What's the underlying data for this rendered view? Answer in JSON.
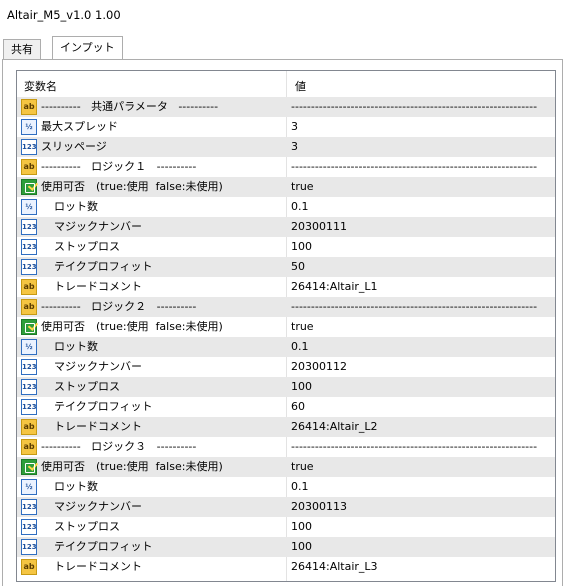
{
  "window": {
    "title": "Altair_M5_v1.0 1.00"
  },
  "tabs": [
    {
      "label": "共有"
    },
    {
      "label": "インプット"
    }
  ],
  "grid": {
    "col_name": "変数名",
    "col_value": "値",
    "rows": [
      {
        "icon": "ab",
        "indent": false,
        "name": "----------   共通パラメータ   ----------",
        "value": "--------------------------------------------------------------"
      },
      {
        "icon": "half",
        "indent": false,
        "name": "最大スプレッド",
        "value": "3"
      },
      {
        "icon": "123",
        "indent": false,
        "name": "スリッページ",
        "value": "3"
      },
      {
        "icon": "ab",
        "indent": false,
        "name": "----------   ロジック１   ----------",
        "value": "--------------------------------------------------------------"
      },
      {
        "icon": "bool",
        "indent": false,
        "name": "使用可否　(true:使用  false:未使用)",
        "value": "true"
      },
      {
        "icon": "half",
        "indent": true,
        "name": "ロット数",
        "value": "0.1"
      },
      {
        "icon": "123",
        "indent": true,
        "name": "マジックナンバー",
        "value": "20300111"
      },
      {
        "icon": "123",
        "indent": true,
        "name": "ストップロス",
        "value": "100"
      },
      {
        "icon": "123",
        "indent": true,
        "name": "テイクプロフィット",
        "value": "50"
      },
      {
        "icon": "ab",
        "indent": true,
        "name": "トレードコメント",
        "value": "26414:Altair_L1"
      },
      {
        "icon": "ab",
        "indent": false,
        "name": "----------   ロジック２   ----------",
        "value": "--------------------------------------------------------------"
      },
      {
        "icon": "bool",
        "indent": false,
        "name": "使用可否　(true:使用  false:未使用)",
        "value": "true"
      },
      {
        "icon": "half",
        "indent": true,
        "name": "ロット数",
        "value": "0.1"
      },
      {
        "icon": "123",
        "indent": true,
        "name": "マジックナンバー",
        "value": "20300112"
      },
      {
        "icon": "123",
        "indent": true,
        "name": "ストップロス",
        "value": "100"
      },
      {
        "icon": "123",
        "indent": true,
        "name": "テイクプロフィット",
        "value": "60"
      },
      {
        "icon": "ab",
        "indent": true,
        "name": "トレードコメント",
        "value": "26414:Altair_L2"
      },
      {
        "icon": "ab",
        "indent": false,
        "name": "----------   ロジック３   ----------",
        "value": "--------------------------------------------------------------"
      },
      {
        "icon": "bool",
        "indent": false,
        "name": "使用可否　(true:使用  false:未使用)",
        "value": "true"
      },
      {
        "icon": "half",
        "indent": true,
        "name": "ロット数",
        "value": "0.1"
      },
      {
        "icon": "123",
        "indent": true,
        "name": "マジックナンバー",
        "value": "20300113"
      },
      {
        "icon": "123",
        "indent": true,
        "name": "ストップロス",
        "value": "100"
      },
      {
        "icon": "123",
        "indent": true,
        "name": "テイクプロフィット",
        "value": "100"
      },
      {
        "icon": "ab",
        "indent": true,
        "name": "トレードコメント",
        "value": "26414:Altair_L3"
      }
    ]
  }
}
